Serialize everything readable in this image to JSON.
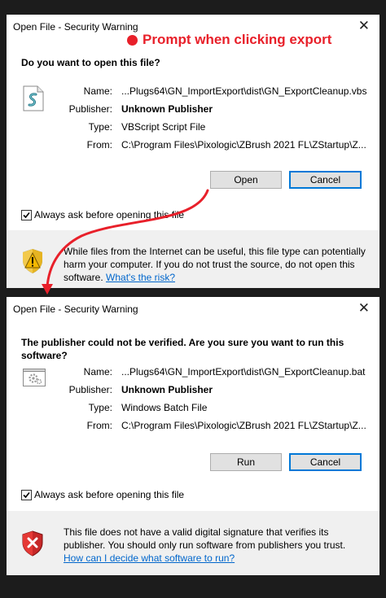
{
  "annotation": {
    "text": "Prompt when clicking export",
    "color": "#e8202a"
  },
  "dialog1": {
    "title": "Open File - Security Warning",
    "close": "✕",
    "heading": "Do you want to open this file?",
    "file_icon": "vbscript-file-icon",
    "fields": [
      {
        "label": "Name:",
        "value": "...Plugs64\\GN_ImportExport\\dist\\GN_ExportCleanup.vbs"
      },
      {
        "label": "Publisher:",
        "value": "Unknown Publisher"
      },
      {
        "label": "Type:",
        "value": "VBScript Script File"
      },
      {
        "label": "From:",
        "value": "C:\\Program Files\\Pixologic\\ZBrush 2021 FL\\ZStartup\\Z..."
      }
    ],
    "primary_button": "Open",
    "cancel_button": "Cancel",
    "checkbox_label": "Always ask before opening this file",
    "checkbox_checked": true,
    "warning_icon": "shield-warning-icon",
    "warning_text": "While files from the Internet can be useful, this file type can potentially harm your computer. If you do not trust the source, do not open this software.",
    "warning_link": "What's the risk?"
  },
  "dialog2": {
    "title": "Open File - Security Warning",
    "close": "✕",
    "heading": "The publisher could not be verified.  Are you sure you want to run this software?",
    "file_icon": "batch-file-gear-icon",
    "fields": [
      {
        "label": "Name:",
        "value": "...Plugs64\\GN_ImportExport\\dist\\GN_ExportCleanup.bat"
      },
      {
        "label": "Publisher:",
        "value": "Unknown Publisher"
      },
      {
        "label": "Type:",
        "value": "Windows Batch File"
      },
      {
        "label": "From:",
        "value": "C:\\Program Files\\Pixologic\\ZBrush 2021 FL\\ZStartup\\Z..."
      }
    ],
    "primary_button": "Run",
    "cancel_button": "Cancel",
    "checkbox_label": "Always ask before opening this file",
    "checkbox_checked": true,
    "warning_icon": "shield-error-icon",
    "warning_text": "This file does not have a valid digital signature that verifies its publisher.  You should only run software from publishers you trust.",
    "warning_link": "How can I decide what software to run?"
  }
}
